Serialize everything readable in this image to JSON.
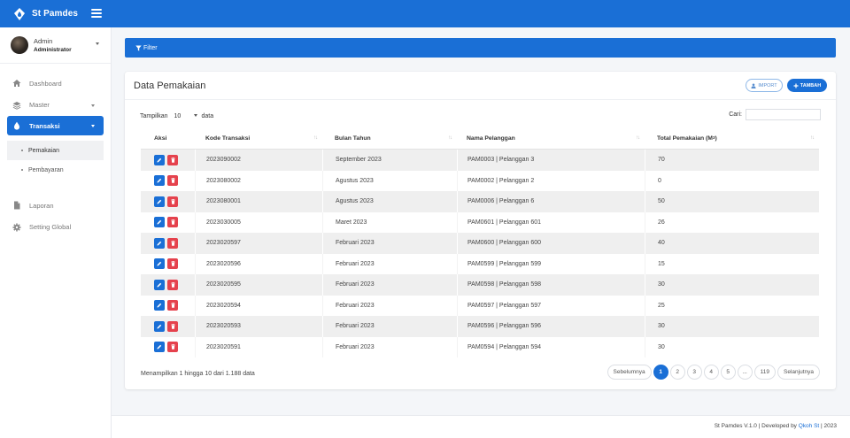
{
  "brand": {
    "name": "St Pamdes"
  },
  "user": {
    "name": "Admin",
    "role": "Administrator"
  },
  "sidebar": {
    "items": [
      {
        "label": "Dashboard"
      },
      {
        "label": "Master"
      },
      {
        "label": "Transaksi"
      },
      {
        "label": "Laporan"
      },
      {
        "label": "Setting Global"
      }
    ],
    "sub_items": [
      {
        "label": "Pemakaian"
      },
      {
        "label": "Pembayaran"
      }
    ]
  },
  "filter": {
    "label": "Filter"
  },
  "card": {
    "title": "Data Pemakaian",
    "import_label": "IMPORT",
    "add_label": "TAMBAH"
  },
  "length": {
    "prefix": "Tampilkan",
    "value": "10",
    "suffix": "data"
  },
  "search": {
    "label": "Cari:",
    "value": ""
  },
  "table": {
    "headers": {
      "aksi": "Aksi",
      "kode": "Kode Transaksi",
      "bulan": "Bulan Tahun",
      "pelanggan": "Nama Pelanggan",
      "total": "Total Pemakaian (M",
      "total_sup": "3",
      "total_close": ")"
    },
    "rows": [
      {
        "kode": "2023090002",
        "bulan": "September 2023",
        "pelanggan": "PAM0003 | Pelanggan 3",
        "total": "70"
      },
      {
        "kode": "2023080002",
        "bulan": "Agustus 2023",
        "pelanggan": "PAM0002 | Pelanggan 2",
        "total": "0"
      },
      {
        "kode": "2023080001",
        "bulan": "Agustus 2023",
        "pelanggan": "PAM0006 | Pelanggan 6",
        "total": "50"
      },
      {
        "kode": "2023030005",
        "bulan": "Maret 2023",
        "pelanggan": "PAM0601 | Pelanggan 601",
        "total": "26"
      },
      {
        "kode": "2023020597",
        "bulan": "Februari 2023",
        "pelanggan": "PAM0600 | Pelanggan 600",
        "total": "40"
      },
      {
        "kode": "2023020596",
        "bulan": "Februari 2023",
        "pelanggan": "PAM0599 | Pelanggan 599",
        "total": "15"
      },
      {
        "kode": "2023020595",
        "bulan": "Februari 2023",
        "pelanggan": "PAM0598 | Pelanggan 598",
        "total": "30"
      },
      {
        "kode": "2023020594",
        "bulan": "Februari 2023",
        "pelanggan": "PAM0597 | Pelanggan 597",
        "total": "25"
      },
      {
        "kode": "2023020593",
        "bulan": "Februari 2023",
        "pelanggan": "PAM0596 | Pelanggan 596",
        "total": "30"
      },
      {
        "kode": "2023020591",
        "bulan": "Februari 2023",
        "pelanggan": "PAM0594 | Pelanggan 594",
        "total": "30"
      }
    ]
  },
  "info": "Menampilkan 1 hingga 10 dari 1.188 data",
  "pagination": {
    "prev": "Sebelumnya",
    "pages": [
      "1",
      "2",
      "3",
      "4",
      "5",
      "...",
      "119"
    ],
    "next": "Selanjutnya"
  },
  "footer": {
    "text": "St Pamdes V.1.0 | Developed by ",
    "link": "Qkoh St",
    "suffix": " | 2023"
  },
  "colors": {
    "primary": "#1a6fd6",
    "danger": "#e5424d"
  },
  "icons": {
    "brand": "water-drop-logo-icon",
    "menu": "hamburger-icon",
    "dashboard": "home-icon",
    "master": "layers-icon",
    "transaksi": "water-drop-icon",
    "laporan": "file-icon",
    "setting": "gear-icon",
    "filter": "filter-icon",
    "import": "user-upload-icon",
    "add": "plus-icon",
    "edit": "pencil-icon",
    "delete": "trash-icon",
    "sort": "sort-icon"
  }
}
